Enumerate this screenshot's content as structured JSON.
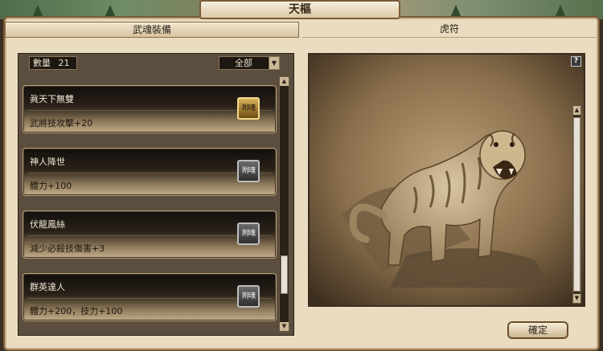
{
  "window": {
    "title": "天樞"
  },
  "tabs": [
    {
      "label": "武魂裝備"
    },
    {
      "label": "虎符"
    }
  ],
  "inventory": {
    "count_label": "數量",
    "count_value": "21",
    "filter_value": "全部"
  },
  "items": [
    {
      "name": "眞天下無雙",
      "effect": "武將技攻擊+20",
      "attach_label": "附魂",
      "active": true
    },
    {
      "name": "神人降世",
      "effect": "體力+100",
      "attach_label": "附魂",
      "active": false
    },
    {
      "name": "伏龍鳳絲",
      "effect": "減少必殺技傷害+3",
      "attach_label": "附魂",
      "active": false
    },
    {
      "name": "群英達人",
      "effect": "體力+200，技力+100",
      "attach_label": "附魂",
      "active": false
    }
  ],
  "left_scrollbar": {
    "position": 0.85
  },
  "right_scrollbar": {
    "position": 0.0
  },
  "help": {
    "label": "?"
  },
  "confirm": {
    "label": "確定"
  },
  "illustration": {
    "subject": "tiger"
  },
  "colors": {
    "frame": "#7a5a36",
    "panel": "#e9dcc0",
    "active_button": "#d8b35a"
  }
}
